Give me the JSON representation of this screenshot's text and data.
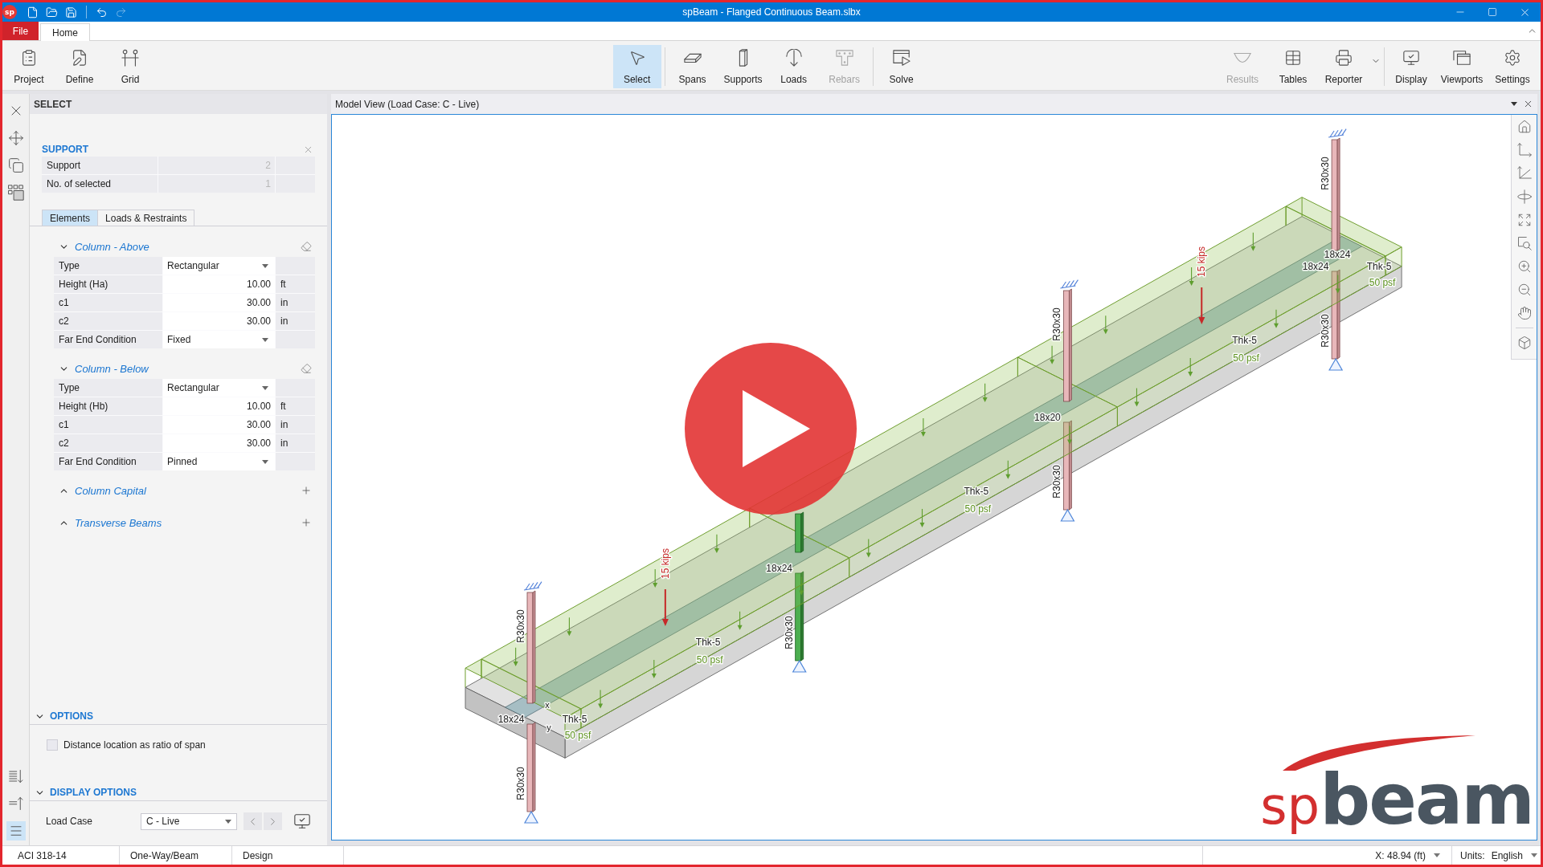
{
  "window": {
    "icon_label": "sp",
    "title": "spBeam - Flanged Continuous Beam.slbx"
  },
  "quick_access": [
    {
      "kind": "new",
      "disabled": false
    },
    {
      "kind": "open",
      "disabled": false
    },
    {
      "kind": "save",
      "disabled": false
    },
    {
      "kind": "undo",
      "disabled": false
    },
    {
      "kind": "redo",
      "disabled": true
    }
  ],
  "menu_tabs": [
    {
      "label": "File",
      "kind": "file",
      "selected": false
    },
    {
      "label": "Home",
      "kind": "tab",
      "selected": true
    }
  ],
  "ribbon": {
    "sections": [
      {
        "groups": [
          [
            {
              "label": "Project",
              "kind": "project",
              "selected": false,
              "disabled": false,
              "dropdown": false
            },
            {
              "label": "Define",
              "kind": "define",
              "selected": false,
              "disabled": false,
              "dropdown": false
            },
            {
              "label": "Grid",
              "kind": "grid",
              "selected": false,
              "disabled": false,
              "dropdown": false
            }
          ]
        ]
      },
      {
        "groups": [
          [
            {
              "label": "Select",
              "kind": "select",
              "selected": true,
              "disabled": false,
              "dropdown": false
            }
          ],
          [
            {
              "label": "Spans",
              "kind": "spans",
              "selected": false,
              "disabled": false,
              "dropdown": false
            },
            {
              "label": "Supports",
              "kind": "supports",
              "selected": false,
              "disabled": false,
              "dropdown": false
            },
            {
              "label": "Loads",
              "kind": "loads",
              "selected": false,
              "disabled": false,
              "dropdown": false
            },
            {
              "label": "Rebars",
              "kind": "rebars",
              "selected": false,
              "disabled": true,
              "dropdown": false
            }
          ],
          [
            {
              "label": "Solve",
              "kind": "solve",
              "selected": false,
              "disabled": false,
              "dropdown": false
            }
          ]
        ]
      },
      {
        "groups": [
          [
            {
              "label": "Results",
              "kind": "results",
              "selected": false,
              "disabled": true,
              "dropdown": false
            },
            {
              "label": "Tables",
              "kind": "tables",
              "selected": false,
              "disabled": false,
              "dropdown": false
            },
            {
              "label": "Reporter",
              "kind": "reporter",
              "selected": false,
              "disabled": false,
              "dropdown": true
            }
          ],
          [
            {
              "label": "Display",
              "kind": "display",
              "selected": false,
              "disabled": false,
              "dropdown": false
            },
            {
              "label": "Viewports",
              "kind": "viewports",
              "selected": false,
              "disabled": false,
              "dropdown": false
            },
            {
              "label": "Settings",
              "kind": "settings",
              "selected": false,
              "disabled": false,
              "dropdown": false
            }
          ]
        ]
      }
    ]
  },
  "side_strip": {
    "view_modes": [
      {
        "kind": "expand",
        "selected": false
      },
      {
        "kind": "collapse",
        "selected": false
      },
      {
        "kind": "list",
        "selected": true
      }
    ]
  },
  "panel": {
    "title": "SELECT",
    "selection": {
      "heading": "SUPPORT",
      "rows": [
        {
          "label": "Support",
          "value": "2"
        },
        {
          "label": "No. of selected",
          "value": "1"
        }
      ]
    },
    "tabs": [
      {
        "label": "Elements",
        "selected": true
      },
      {
        "label": "Loads & Restraints",
        "selected": false
      }
    ],
    "sections": [
      {
        "title": "Column - Above",
        "expanded": true,
        "rows": [
          {
            "label": "Type",
            "kind": "select",
            "value": "Rectangular"
          },
          {
            "label": "Height (Ha)",
            "kind": "number",
            "value": "10.00",
            "unit": "ft"
          },
          {
            "label": "c1",
            "kind": "number",
            "value": "30.00",
            "unit": "in"
          },
          {
            "label": "c2",
            "kind": "number",
            "value": "30.00",
            "unit": "in"
          },
          {
            "label": "Far End Condition",
            "kind": "select",
            "value": "Fixed"
          }
        ]
      },
      {
        "title": "Column - Below",
        "expanded": true,
        "rows": [
          {
            "label": "Type",
            "kind": "select",
            "value": "Rectangular"
          },
          {
            "label": "Height (Hb)",
            "kind": "number",
            "value": "10.00",
            "unit": "ft"
          },
          {
            "label": "c1",
            "kind": "number",
            "value": "30.00",
            "unit": "in"
          },
          {
            "label": "c2",
            "kind": "number",
            "value": "30.00",
            "unit": "in"
          },
          {
            "label": "Far End Condition",
            "kind": "select",
            "value": "Pinned"
          }
        ]
      },
      {
        "title": "Column Capital",
        "expanded": false
      },
      {
        "title": "Transverse Beams",
        "expanded": false
      }
    ],
    "options": {
      "title": "OPTIONS",
      "expanded": true,
      "checkbox": {
        "label": "Distance location as ratio of span",
        "checked": false
      }
    },
    "display_options": {
      "title": "DISPLAY OPTIONS",
      "expanded": true,
      "load_case": {
        "label": "Load Case",
        "value": "C - Live"
      }
    }
  },
  "model_view": {
    "title": "Model View (Load Case: C - Live)",
    "axes": [
      "x",
      "y"
    ],
    "supports": [
      {
        "selected": false,
        "column_above": "R30x30",
        "column_below": "R30x30",
        "sections": [
          "18x24"
        ]
      },
      {
        "selected": true,
        "column_below": "R30x30",
        "sections": [
          "18x24"
        ]
      },
      {
        "selected": false,
        "column_above": "R30x30",
        "column_below": "R30x30",
        "sections": [
          "18x20"
        ]
      },
      {
        "selected": false,
        "column_above": "R30x30",
        "column_below": "R30x30",
        "sections": [
          "18x24",
          "18x24"
        ]
      }
    ],
    "segments": [
      {
        "kind": "cantilever",
        "slab": "Thk-5",
        "load": "50 psf"
      },
      {
        "kind": "span",
        "slab": "Thk-5",
        "load": "50 psf",
        "point_load": "15 kips"
      },
      {
        "kind": "span",
        "slab": "Thk-5",
        "load": "50 psf"
      },
      {
        "kind": "span",
        "slab": "Thk-5",
        "load": "50 psf",
        "point_load": "15 kips"
      },
      {
        "kind": "cantilever",
        "slab": "Thk-5",
        "load": "50 psf"
      }
    ]
  },
  "logo": {
    "prefix": "sp",
    "name": "beam"
  },
  "status_bar": {
    "cells": [
      "ACI 318-14",
      "One-Way/Beam",
      "Design"
    ],
    "position": "X: 48.94 (ft)",
    "units_label": "Units:",
    "units": "English"
  }
}
